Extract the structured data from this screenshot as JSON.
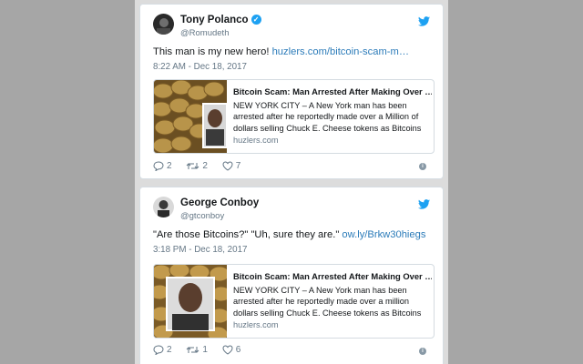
{
  "tweets": [
    {
      "name": "Tony Polanco",
      "handle": "@Romudeth",
      "text": "This man is my new hero! ",
      "link": "huzlers.com/bitcoin-scam-m…",
      "time": "8:22 AM - Dec 18, 2017",
      "card": {
        "title": "Bitcoin Scam: Man Arrested After Making Over …",
        "desc": "NEW YORK CITY – A New York man has been arrested after he reportedly made over a Million of dollars selling Chuck E. Cheese tokens as Bitcoins",
        "domain": "huzlers.com"
      },
      "replies": "2",
      "retweets": "2",
      "likes": "7"
    },
    {
      "name": "George Conboy",
      "handle": "@gtconboy",
      "text": "\"Are those Bitcoins?\" \"Uh, sure they are.\" ",
      "link": "ow.ly/Brkw30hiegs",
      "time": "3:18 PM - Dec 18, 2017",
      "card": {
        "title": "Bitcoin Scam: Man Arrested After Making Over …",
        "desc": "NEW YORK CITY – A New York man has been arrested after he reportedly made over a million dollars selling Chuck E. Cheese tokens as Bitcoins",
        "domain": "huzlers.com"
      },
      "replies": "2",
      "retweets": "1",
      "likes": "6"
    }
  ],
  "colors": {
    "link": "#2b7bb9",
    "verified": "#1da1f2",
    "muted": "#657786"
  },
  "icons": [
    "verified-badge-icon",
    "twitter-bird-icon",
    "reply-icon",
    "retweet-icon",
    "like-icon",
    "info-icon"
  ]
}
